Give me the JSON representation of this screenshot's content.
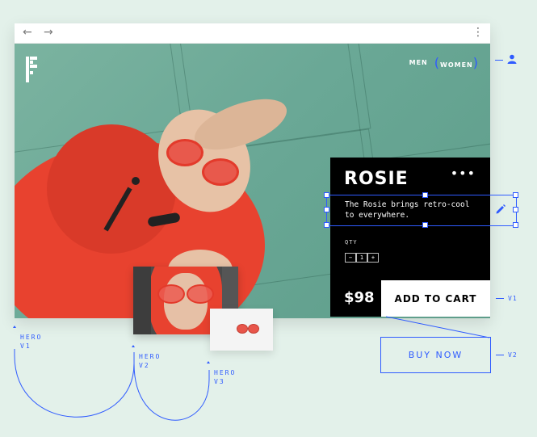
{
  "browser": {
    "back_icon": "arrow-left-icon",
    "forward_icon": "arrow-right-icon",
    "menu_icon": "kebab-menu-icon"
  },
  "site": {
    "logo": "F",
    "gender_nav": [
      "MEN",
      "WOMEN"
    ],
    "selected_gender": "WOMEN",
    "user_icon": "user-icon"
  },
  "product": {
    "name": "ROSIE",
    "more_icon": "ellipsis-icon",
    "description": "The Rosie brings retro-cool to everywhere.",
    "qty_label": "QTY",
    "qty_controls": [
      "−",
      "1",
      "+"
    ],
    "price": "$98",
    "cta": "ADD TO CART",
    "edit_icon": "pencil-icon"
  },
  "variants": {
    "cta_v1": "V1",
    "cta_v2_label": "BUY NOW",
    "cta_v2": "V2",
    "hero_v1": "HERO\nV1",
    "hero_v2": "HERO\nV2",
    "hero_v3": "HERO\nV3"
  },
  "colors": {
    "background": "#e3f1ea",
    "accent": "#2f5bff",
    "hoodie": "#e8422f",
    "panel": "#000000"
  }
}
